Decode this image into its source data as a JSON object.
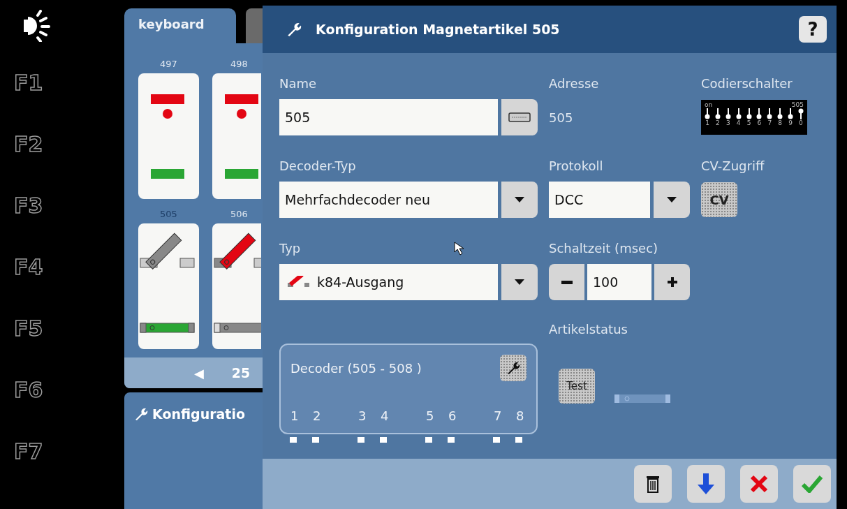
{
  "function_keys": [
    "F1",
    "F2",
    "F3",
    "F4",
    "F5",
    "F6",
    "F7"
  ],
  "keyboard_panel": {
    "tabs": [
      {
        "label": "keyboard",
        "selected": true
      },
      {
        "selected": false
      }
    ],
    "articles": [
      {
        "number": "497",
        "kind": "signal",
        "selected": false
      },
      {
        "number": "498",
        "kind": "signal",
        "selected": false
      },
      {
        "number": "505",
        "kind": "turnout",
        "selected": true,
        "diverging": false
      },
      {
        "number": "506",
        "kind": "turnout",
        "selected": false,
        "diverging": true
      }
    ],
    "prev": "◀",
    "page": "25"
  },
  "config_panel": {
    "title": "Konfiguratio"
  },
  "dialog": {
    "title": "Konfiguration Magnetartikel 505",
    "help": "?",
    "name": {
      "label": "Name",
      "value": "505"
    },
    "address": {
      "label": "Adresse",
      "value": "505"
    },
    "coding_switch": {
      "label": "Codierschalter",
      "on_label": "on",
      "code": "505",
      "switches": [
        {
          "label": "1",
          "on": false
        },
        {
          "label": "2",
          "on": false
        },
        {
          "label": "3",
          "on": false
        },
        {
          "label": "4",
          "on": false
        },
        {
          "label": "5",
          "on": false
        },
        {
          "label": "6",
          "on": false
        },
        {
          "label": "7",
          "on": false
        },
        {
          "label": "8",
          "on": false
        },
        {
          "label": "9",
          "on": false
        },
        {
          "label": "0",
          "on": true
        }
      ]
    },
    "decoder_type": {
      "label": "Decoder-Typ",
      "value": "Mehrfachdecoder neu"
    },
    "protocol": {
      "label": "Protokoll",
      "value": "DCC"
    },
    "cv_access": {
      "label": "CV-Zugriff",
      "button": "CV"
    },
    "type": {
      "label": "Typ",
      "value": "k84-Ausgang"
    },
    "switch_time": {
      "label": "Schaltzeit (msec)",
      "value": "100"
    },
    "article_status": {
      "label": "Artikelstatus",
      "test": "Test"
    },
    "decoder": {
      "title": "Decoder (505 - 508 )",
      "outputs": [
        "1",
        "2",
        "3",
        "4",
        "5",
        "6",
        "7",
        "8"
      ]
    }
  }
}
